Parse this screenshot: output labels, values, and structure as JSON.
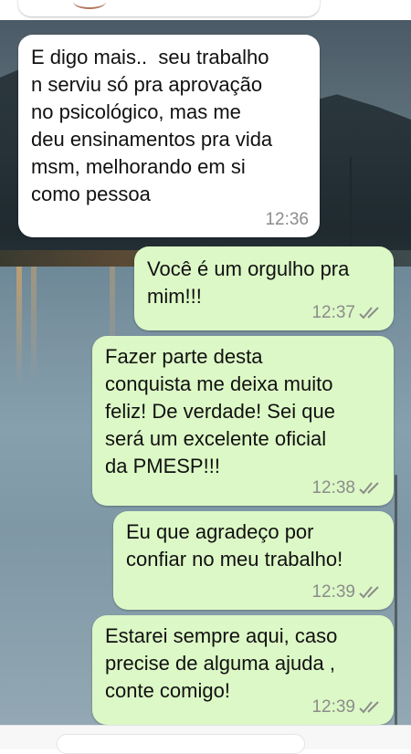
{
  "messages": [
    {
      "direction": "incoming",
      "text": "E digo mais..  seu trabalho\nn serviu só pra aprovação\nno psicológico, mas me\ndeu ensinamentos pra vida\nmsm, melhorando em si\ncomo pessoa",
      "time": "12:36",
      "status": ""
    },
    {
      "direction": "outgoing",
      "text": "Você é um orgulho pra\nmim!!!",
      "time": "12:37",
      "status": "read"
    },
    {
      "direction": "outgoing",
      "text": "Fazer parte desta\nconquista me deixa muito\nfeliz! De verdade! Sei que\nserá um excelente oficial\nda PMESP!!!",
      "time": "12:38",
      "status": "read"
    },
    {
      "direction": "outgoing",
      "text": "Eu que agradeço por\nconfiar no meu trabalho!",
      "time": "12:39",
      "status": "read"
    },
    {
      "direction": "outgoing",
      "text": "Estarei sempre aqui, caso\nprecise de alguma ajuda ,\nconte comigo!",
      "time": "12:39",
      "status": "read"
    }
  ],
  "colors": {
    "incoming_bubble": "#ffffff",
    "outgoing_bubble": "#dcf8c6",
    "timestamp": "#8c8c8c",
    "read_ticks": "#8c8c8c"
  },
  "icons": {
    "read_receipt": "double-check-icon"
  }
}
